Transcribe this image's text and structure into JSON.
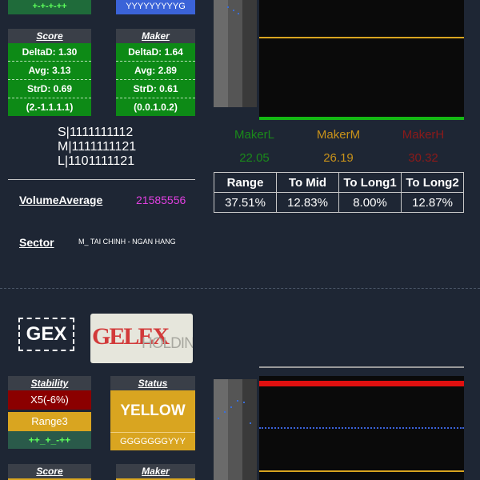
{
  "top": {
    "stability_bottom": "+-+-+-++",
    "status_bottom": "YYYYYYYYYG",
    "score": {
      "title": "Score",
      "delta": "DeltaD: 1.30",
      "avg": "Avg: 3.13",
      "std": "StrD: 0.69",
      "seq": "(2.-1.1.1.1)"
    },
    "maker": {
      "title": "Maker",
      "delta": "DeltaD: 1.64",
      "avg": "Avg: 2.89",
      "std": "StrD: 0.61",
      "seq": "(0.0.1.0.2)"
    },
    "sml": [
      "S|1111111112",
      "M|1111111121",
      "L|1101111121"
    ],
    "volume_label": "VolumeAverage",
    "volume_value": "21585556",
    "sector_label": "Sector",
    "sector_value": "M_ TAI CHINH - NGAN HANG",
    "makers": [
      {
        "label": "MakerL",
        "value": "22.05",
        "color": "#1a8a1a"
      },
      {
        "label": "MakerM",
        "value": "26.19",
        "color": "#c8921a"
      },
      {
        "label": "MakerH",
        "value": "30.32",
        "color": "#8b1a1a"
      }
    ],
    "stats_headers": [
      "Range",
      "To Mid",
      "To Long1",
      "To Long2"
    ],
    "stats_values": [
      "37.51%",
      "12.83%",
      "8.00%",
      "12.87%"
    ]
  },
  "bottom": {
    "ticker": "GEX",
    "logo_text": "GELEX",
    "logo_sub": "HOLDINGS",
    "stability": {
      "title": "Stability",
      "value": "X5(-6%)",
      "range": "Range3",
      "pattern": "++_+_-++"
    },
    "status": {
      "title": "Status",
      "value": "YELLOW",
      "pattern": "GGGGGGGYYY"
    },
    "score_title": "Score",
    "maker_title": "Maker"
  },
  "colors": {
    "bg": "#1e2634",
    "green": "#0d8a16",
    "red": "#8b0000",
    "yellow": "#d9a520",
    "magenta": "#e040e0",
    "blue": "#3b63d8"
  }
}
